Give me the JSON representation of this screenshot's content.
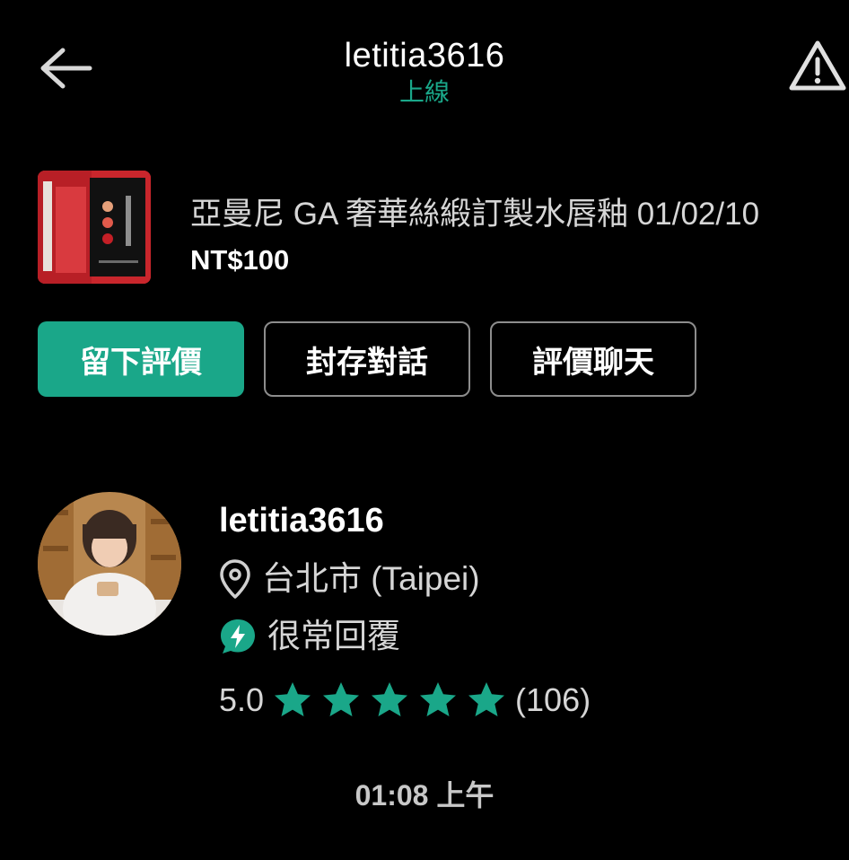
{
  "header": {
    "username": "letitia3616",
    "status": "上線"
  },
  "product": {
    "title": "亞曼尼 GA 奢華絲緞訂製水唇釉 01/02/10",
    "price": "NT$100"
  },
  "actions": {
    "leave_review": "留下評價",
    "archive_chat": "封存對話",
    "rate_chat": "評價聊天"
  },
  "seller": {
    "name": "letitia3616",
    "location": "台北市 (Taipei)",
    "reply_badge": "很常回覆",
    "rating": "5.0",
    "stars": 5,
    "review_count": "(106)"
  },
  "chat": {
    "timestamp": "01:08 上午"
  },
  "colors": {
    "accent": "#1aa789",
    "background": "#000000",
    "text_secondary": "#d6d6d6"
  }
}
